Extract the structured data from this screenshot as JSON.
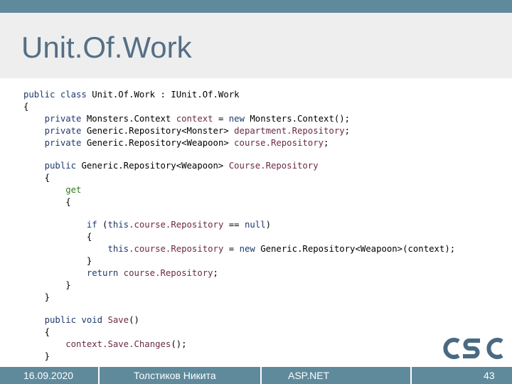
{
  "slide": {
    "title": "Unit.Of.Work"
  },
  "code": {
    "l1": {
      "kw": "public class",
      "rest": " Unit.Of.Work : IUnit.Of.Work"
    },
    "l2": {
      "text": "{"
    },
    "l3": {
      "kw": "private",
      "type": " Monsters.Context",
      "name": " context",
      "eq": " = ",
      "new_kw": "new",
      "rest": " Monsters.Context();"
    },
    "l4": {
      "kw": "private",
      "type": " Generic.Repository<Monster>",
      "name": " department.Repository",
      "end": ";"
    },
    "l5": {
      "kw": "private",
      "type": " Generic.Repository<Weapoon>",
      "name": " course.Repository",
      "end": ";"
    },
    "l6": {
      "kw": "public",
      "type": " Generic.Repository<Weapoon>",
      "name": " Course.Repository"
    },
    "l7": {
      "text": "{"
    },
    "l8": {
      "kw": "get"
    },
    "l9": {
      "text": "{"
    },
    "l10": {
      "kw": "if",
      "p1": " (",
      "this_kw": "this",
      "name": ".course.Repository",
      "op": " == ",
      "null_kw": "null",
      "p2": ")"
    },
    "l11": {
      "text": "{"
    },
    "l12": {
      "this_kw": "this",
      "name": ".course.Repository",
      "eq": " = ",
      "new_kw": "new",
      "rest": " Generic.Repository<Weapoon>(context);"
    },
    "l13": {
      "text": "}"
    },
    "l14": {
      "kw": "return",
      "name": " course.Repository",
      "end": ";"
    },
    "l15": {
      "text": "}"
    },
    "l16": {
      "text": "}"
    },
    "l17": {
      "kw": "public void",
      "name": " Save",
      "end": "()"
    },
    "l18": {
      "text": "{"
    },
    "l19": {
      "obj": "context",
      "name": ".Save.Changes",
      "end": "();"
    },
    "l20": {
      "text": "}"
    }
  },
  "footer": {
    "date": "16.09.2020",
    "author": "Толстиков Никита",
    "course": "ASP.NET",
    "page": "43"
  },
  "logo": {
    "text": "CSC",
    "color": "#4a6a83"
  },
  "colors": {
    "bar": "#5f8a9c",
    "title": "#546f86",
    "title_band": "#eeeeee"
  }
}
